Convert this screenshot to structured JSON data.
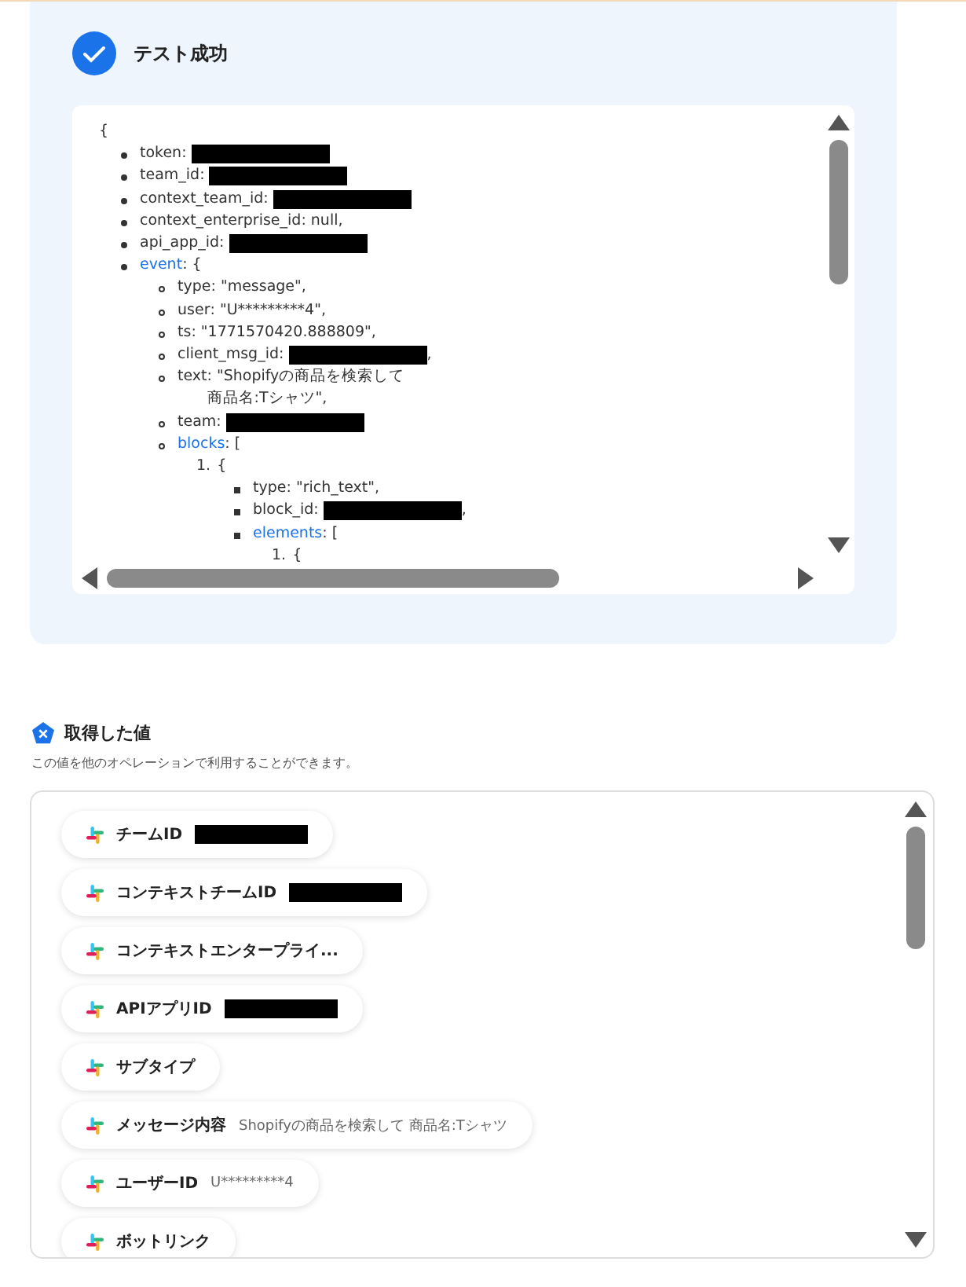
{
  "result": {
    "title": "テスト成功",
    "success": true,
    "code": {
      "open": "{",
      "kind": "disc",
      "items": [
        {
          "key": "token",
          "value": ":",
          "redacted": true
        },
        {
          "key": "team_id",
          "value": ":",
          "redacted": true
        },
        {
          "key": "context_team_id",
          "value": ":",
          "redacted": true
        },
        {
          "key": "context_enterprise_id",
          "value": ": null,"
        },
        {
          "key": "api_app_id",
          "value": ":",
          "redacted": true
        },
        {
          "key": "event",
          "link": true,
          "value": ": {",
          "children": {
            "kind": "circle",
            "items": [
              {
                "key": "type",
                "value": ": \"message\","
              },
              {
                "key": "user",
                "value": ": \"U*********4\","
              },
              {
                "key": "ts",
                "value": ": \"1771570420.888809\","
              },
              {
                "key": "client_msg_id",
                "value": ":",
                "redacted": true,
                "after": ","
              },
              {
                "key": "text",
                "value": ": \"Shopifyの商品を検索して商品名:Tシャツ\","
              },
              {
                "key": "team",
                "value": ":",
                "redacted": true
              },
              {
                "key": "blocks",
                "link": true,
                "value": ": [",
                "children": {
                  "kind": "numbered",
                  "items": [
                    {
                      "marker": "1.",
                      "value": "{",
                      "children": {
                        "kind": "square",
                        "items": [
                          {
                            "key": "type",
                            "value": ": \"rich_text\","
                          },
                          {
                            "key": "block_id",
                            "value": ":",
                            "redacted": true,
                            "after": ","
                          },
                          {
                            "key": "elements",
                            "link": true,
                            "value": ": [",
                            "children": {
                              "kind": "numbered",
                              "items": [
                                {
                                  "marker": "1.",
                                  "value": "{"
                                }
                              ]
                            }
                          }
                        ]
                      }
                    }
                  ]
                }
              }
            ]
          }
        }
      ]
    }
  },
  "values": {
    "title": "取得した値",
    "description": "この値を他のオペレーションで利用することができます。",
    "items": [
      {
        "label": "チームID",
        "redacted": true
      },
      {
        "label": "コンテキストチームID",
        "redacted": true
      },
      {
        "label": "コンテキストエンタープライ..."
      },
      {
        "label": "APIアプリID",
        "redacted": true
      },
      {
        "label": "サブタイプ"
      },
      {
        "label": "メッセージ内容",
        "value": "Shopifyの商品を検索して 商品名:Tシャツ"
      },
      {
        "label": "ユーザーID",
        "value": "U*********4"
      },
      {
        "label": "ボットリンク"
      }
    ]
  }
}
